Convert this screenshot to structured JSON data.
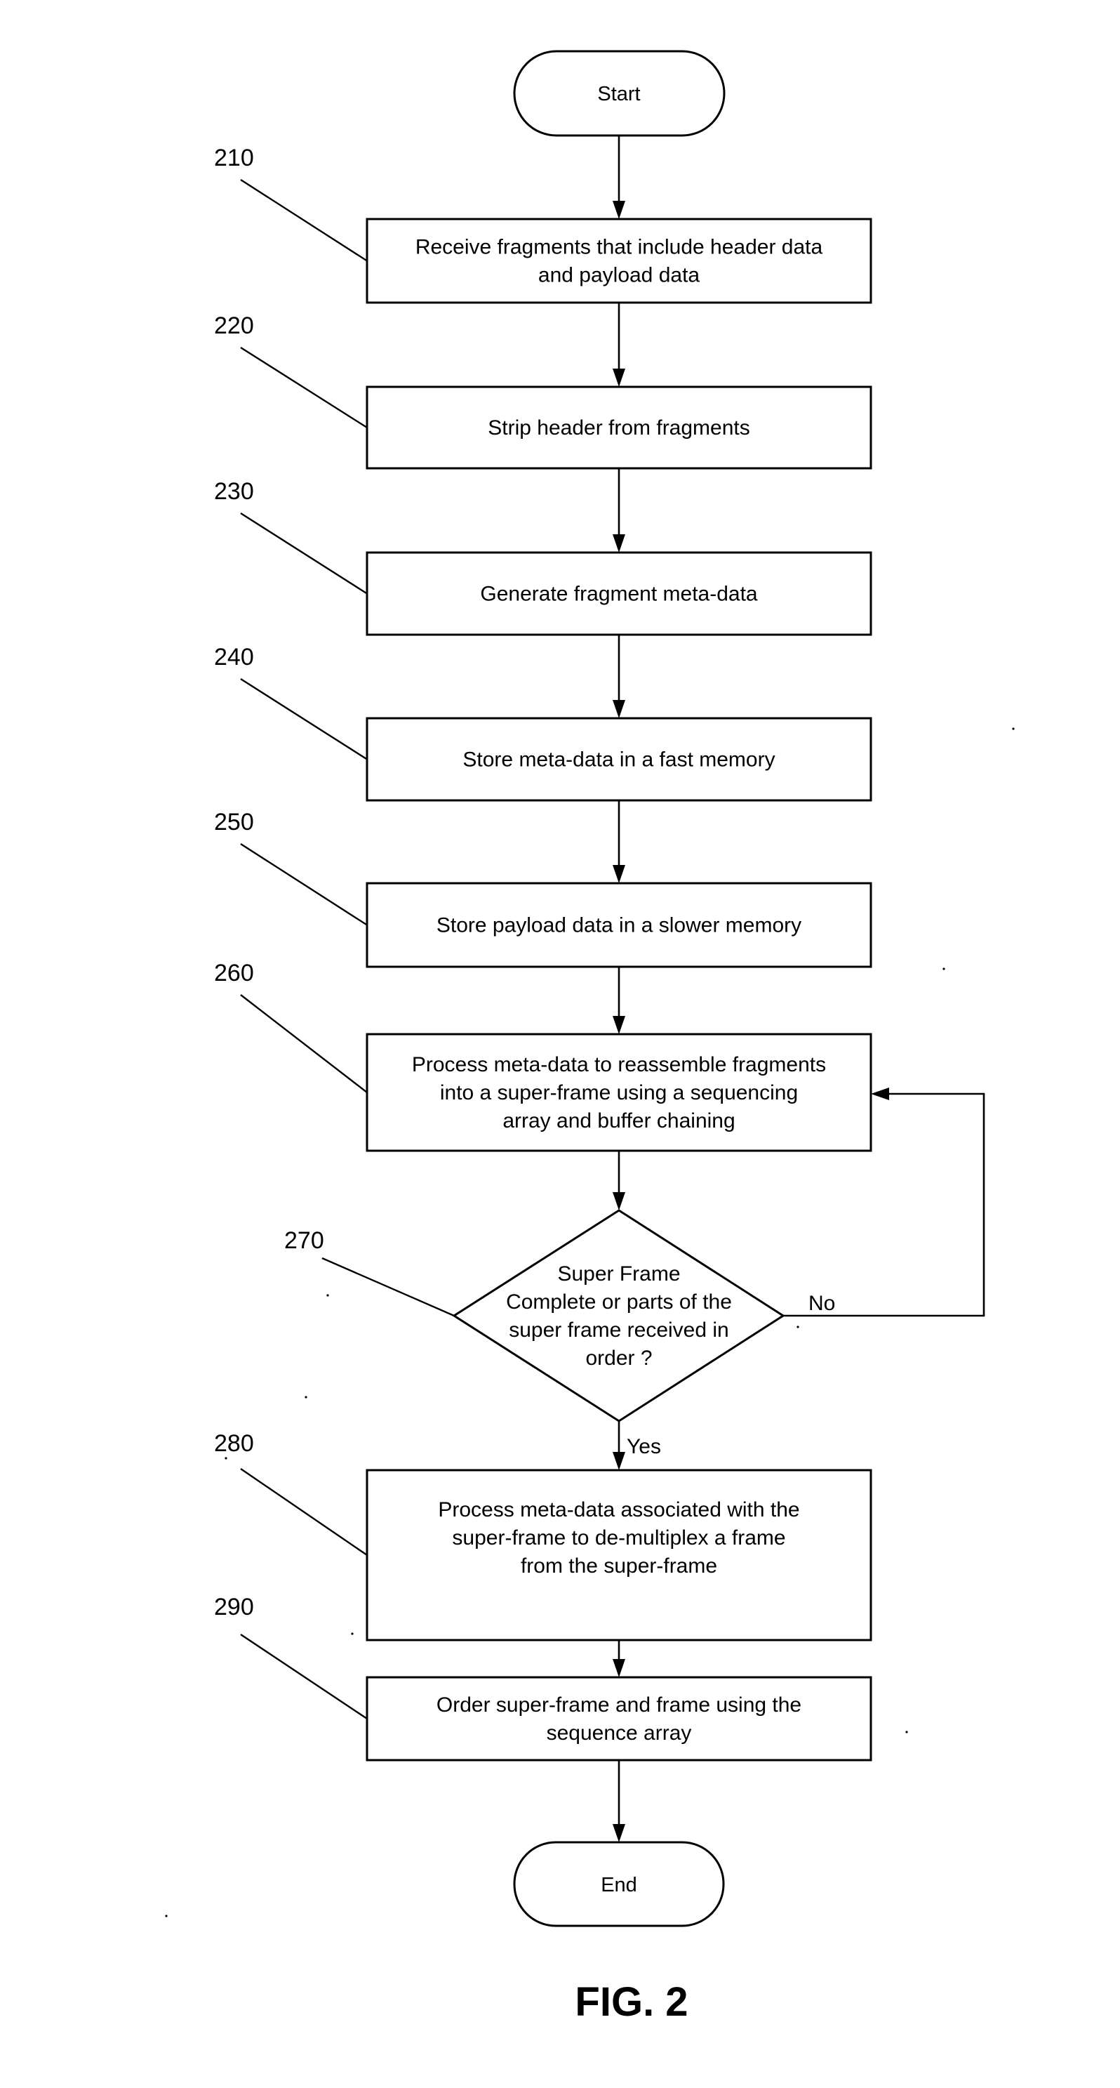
{
  "figure": {
    "caption": "FIG. 2",
    "type": "flowchart"
  },
  "terminals": {
    "start": "Start",
    "end": "End"
  },
  "steps": [
    {
      "ref": "210",
      "lines": [
        "Receive fragments that include header data",
        "and payload data"
      ]
    },
    {
      "ref": "220",
      "lines": [
        "Strip header from fragments"
      ]
    },
    {
      "ref": "230",
      "lines": [
        "Generate fragment meta-data"
      ]
    },
    {
      "ref": "240",
      "lines": [
        "Store meta-data in a fast memory"
      ]
    },
    {
      "ref": "250",
      "lines": [
        "Store payload data in a slower memory"
      ]
    },
    {
      "ref": "260",
      "lines": [
        "Process meta-data to reassemble fragments",
        "into a super-frame using a sequencing",
        "array and buffer chaining"
      ]
    }
  ],
  "decision": {
    "ref": "270",
    "lines": [
      "Super Frame",
      "Complete or parts of the",
      "super frame received in",
      "order ?"
    ],
    "yes_label": "Yes",
    "no_label": "No"
  },
  "post_steps": [
    {
      "ref": "280",
      "lines": [
        "Process meta-data associated with the",
        "super-frame to de-multiplex a frame",
        "from the super-frame"
      ]
    },
    {
      "ref": "290",
      "lines": [
        "Order super-frame and frame using the",
        "sequence array"
      ]
    }
  ]
}
